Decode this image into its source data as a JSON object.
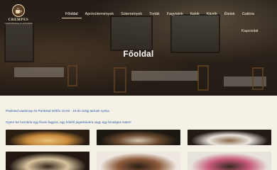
{
  "brand": {
    "name": "CREMPES",
    "subtitle": "CUKRÁSZDA & KÁVÉZÓ"
  },
  "nav": {
    "items": [
      {
        "label": "Főoldal",
        "active": true
      },
      {
        "label": "Aprósütemények",
        "active": false
      },
      {
        "label": "Sütemények",
        "active": false
      },
      {
        "label": "Torták",
        "active": false
      },
      {
        "label": "Fagyiaink",
        "active": false
      },
      {
        "label": "Italok",
        "active": false
      },
      {
        "label": "Kávék",
        "active": false
      },
      {
        "label": "Ételek",
        "active": false
      },
      {
        "label": "Galéria",
        "active": false
      }
    ],
    "row2": [
      {
        "label": "Kapcsolat",
        "active": false
      }
    ]
  },
  "hero": {
    "title": "Főoldal"
  },
  "notice": "Pünkösd vasárnap és Pünkösd hétfőn 10.00 - 19.00 óráig tartunk nyitva.",
  "tagline": "Gyere be hozzánk egy finom fagyira, egy hűsítő jegeskávéra vagy egy fenséges sütire!",
  "cards": [
    {
      "name": "pizza-photo",
      "colors": [
        "#2a1d12",
        "#c8893b",
        "#e8c27a"
      ]
    },
    {
      "name": "tiramisu-photo",
      "colors": [
        "#1d1712",
        "#6a4a30",
        "#d7c6b0"
      ]
    },
    {
      "name": "coffee-cup-photo",
      "colors": [
        "#221a14",
        "#e8e3dc",
        "#8a6a4b"
      ]
    },
    {
      "name": "cappuccino-photo",
      "colors": [
        "#211710",
        "#d8c39e",
        "#3a2a1e"
      ]
    },
    {
      "name": "cake-slice-photo",
      "colors": [
        "#efe8e0",
        "#8c5a3a",
        "#2b2016"
      ]
    },
    {
      "name": "pastry-plate-photo",
      "colors": [
        "#e7e2da",
        "#c85a7a",
        "#3a2a22"
      ]
    }
  ]
}
